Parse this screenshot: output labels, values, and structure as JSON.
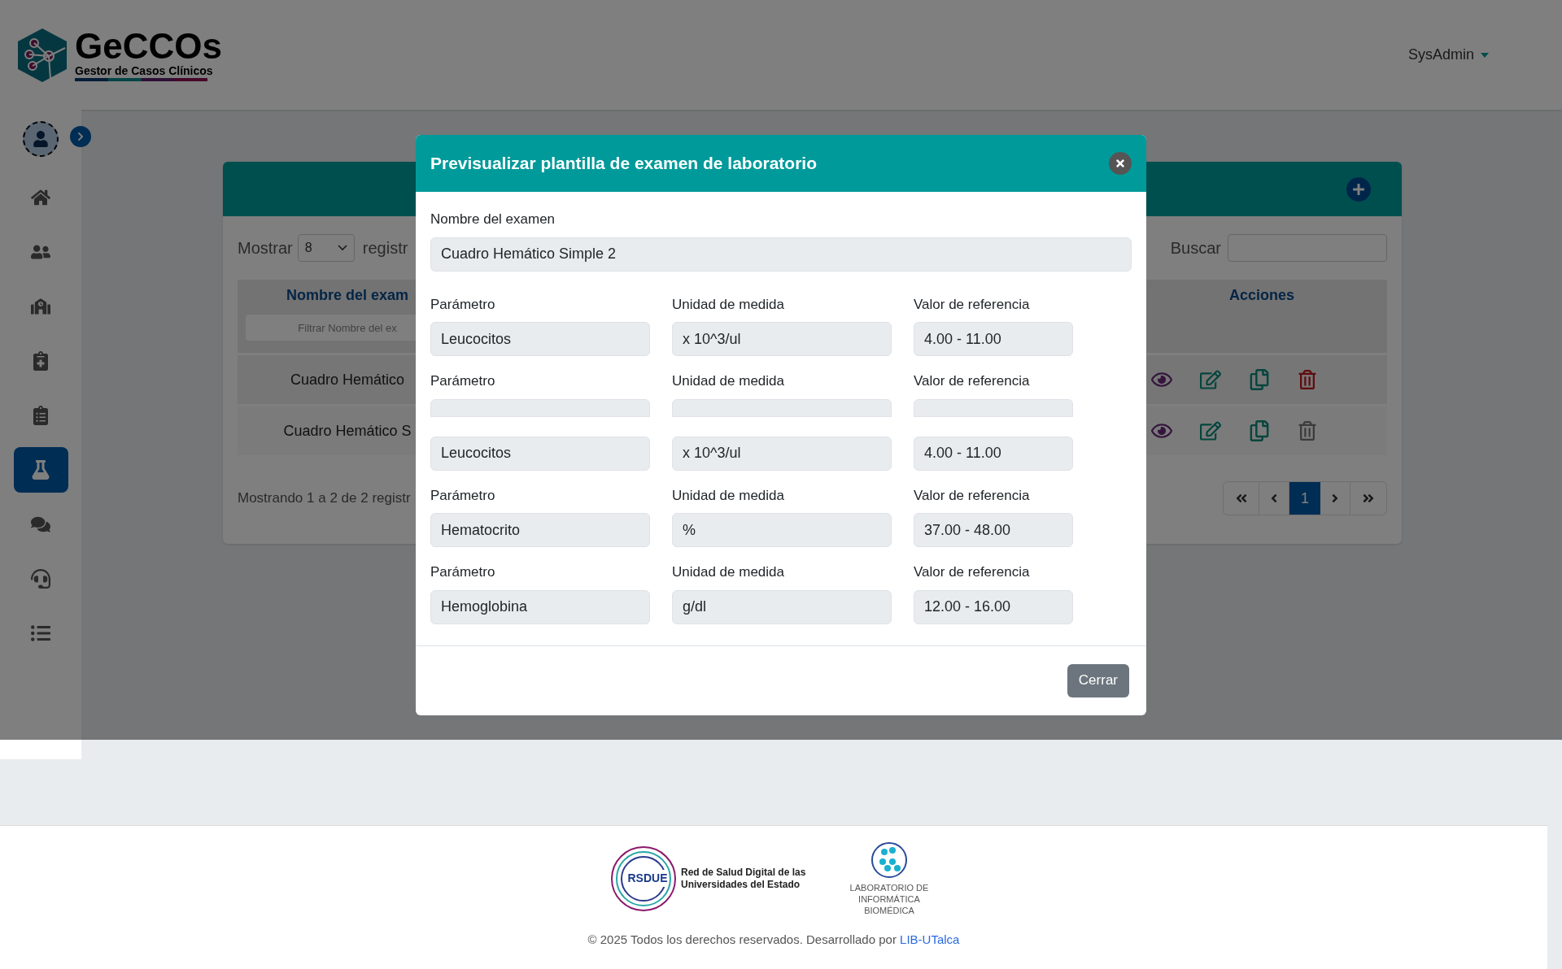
{
  "header": {
    "logo_title": "GeCCOs",
    "logo_subtitle": "Gestor de Casos Clínicos",
    "user_menu": "SysAdmin"
  },
  "sidebar": {
    "items": [
      {
        "selected": false
      },
      {
        "selected": false
      },
      {
        "selected": false
      },
      {
        "selected": false
      },
      {
        "selected": false
      },
      {
        "selected": true
      },
      {
        "selected": false
      },
      {
        "selected": false
      },
      {
        "selected": false
      }
    ]
  },
  "card": {
    "show_label": "Mostrar",
    "page_size": "8",
    "records_label": "registr",
    "search_label": "Buscar",
    "columns": [
      "Nombre del exam",
      "Acciones"
    ],
    "filter_placeholder": "Filtrar Nombre del ex",
    "rows": [
      {
        "name": "Cuadro Hemático",
        "delete_enabled": true
      },
      {
        "name": "Cuadro Hemático S",
        "delete_enabled": false
      }
    ],
    "summary": "Mostrando 1 a 2 de 2 registr",
    "pages": [
      {
        "label": "1",
        "selected": true
      }
    ]
  },
  "modal": {
    "title": "Previsualizar plantilla de examen de laboratorio",
    "exam_label": "Nombre del examen",
    "exam_value": "Cuadro Hemático Simple 2",
    "rows": [
      {
        "kind": "full",
        "labels": [
          "Parámetro",
          "Unidad de medida",
          "Valor de referencia"
        ],
        "values": [
          "Leucocitos",
          "x 10^3/ul",
          "4.00 - 11.00"
        ]
      },
      {
        "kind": "clipped",
        "labels": [
          "Parámetro",
          "Unidad de medida",
          "Valor de referencia"
        ],
        "values": []
      },
      {
        "kind": "fields",
        "labels": [],
        "values": [
          "Leucocitos",
          "x 10^3/ul",
          "4.00 - 11.00"
        ]
      },
      {
        "kind": "full",
        "labels": [
          "Parámetro",
          "Unidad de medida",
          "Valor de referencia"
        ],
        "values": [
          "Hematocrito",
          "%",
          "37.00 - 48.00"
        ]
      },
      {
        "kind": "full",
        "labels": [
          "Parámetro",
          "Unidad de medida",
          "Valor de referencia"
        ],
        "values": [
          "Hemoglobina",
          "g/dl",
          "12.00 - 16.00"
        ]
      }
    ],
    "close_button": "Cerrar"
  },
  "footer": {
    "rsdue_mark": "RSDUE",
    "rsdue_name": "Red de Salud Digital de las Universidades del Estado",
    "lib_name": "LABORATORIO DE INFORMÁTICA BIOMÉDICA",
    "copyright": "© 2025 Todos los derechos reservados. Desarrollado por",
    "link": "LIB-UTalca"
  }
}
